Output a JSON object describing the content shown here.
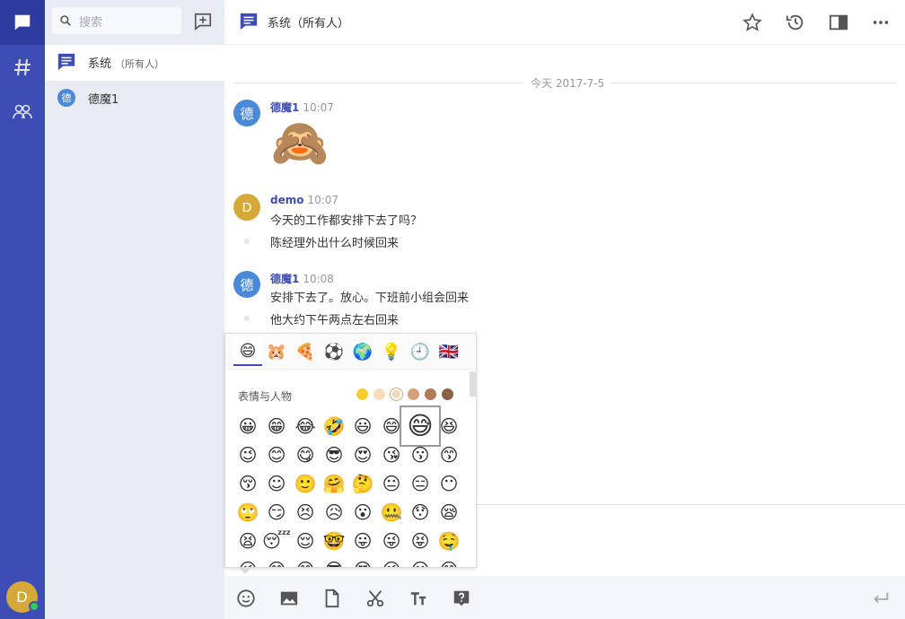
{
  "search": {
    "placeholder": "搜索"
  },
  "sidebar": {
    "active_chat": {
      "name": "系统",
      "sub": "（所有人）"
    },
    "dm": {
      "avatar": "德",
      "name": "德魔1"
    }
  },
  "header": {
    "title": "系统（所有人）"
  },
  "date_separator": "今天 2017-7-5",
  "messages": [
    {
      "avatar": "德",
      "avatar_color": "#4a88d8",
      "author": "德魔1",
      "time": "10:07",
      "sticker": "🙈"
    },
    {
      "avatar": "D",
      "avatar_color": "#d4a93a",
      "author": "demo",
      "time": "10:07",
      "lines": [
        "今天的工作都安排下去了吗？",
        "陈经理外出什么时候回来"
      ]
    },
    {
      "avatar": "德",
      "avatar_color": "#4a88d8",
      "author": "德魔1",
      "time": "10:08",
      "lines": [
        "安排下去了。放心。下班前小组会回来",
        "他大约下午两点左右回来"
      ]
    }
  ],
  "emoji_picker": {
    "category_label": "表情与人物",
    "categories": [
      "😄",
      "🐹",
      "🍕",
      "⚽",
      "🌍",
      "💡",
      "🕘",
      "🇬🇧"
    ],
    "tones": [
      "#f8cc2f",
      "#f9dcb8",
      "#f2d7b8",
      "#d4a27a",
      "#b47a52",
      "#8c6247"
    ],
    "rows": [
      [
        "😀",
        "😁",
        "😂",
        "🤣",
        "😃",
        "😄",
        "😅",
        "😆"
      ],
      [
        "😉",
        "😊",
        "😋",
        "😎",
        "😍",
        "😘",
        "😗",
        "😙"
      ],
      [
        "😚",
        "☺",
        "🙂",
        "🤗",
        "🤔",
        "😐",
        "😑",
        "😶"
      ],
      [
        "🙄",
        "😏",
        "😣",
        "😥",
        "😮",
        "🤐",
        "😯",
        "😪"
      ],
      [
        "😫",
        "😴",
        "😌",
        "🤓",
        "😛",
        "😜",
        "😝",
        "🤤"
      ]
    ]
  },
  "colors": {
    "rail": "#3d4db5",
    "accent": "#3d4db5",
    "sidebar": "#e8ebf2"
  }
}
